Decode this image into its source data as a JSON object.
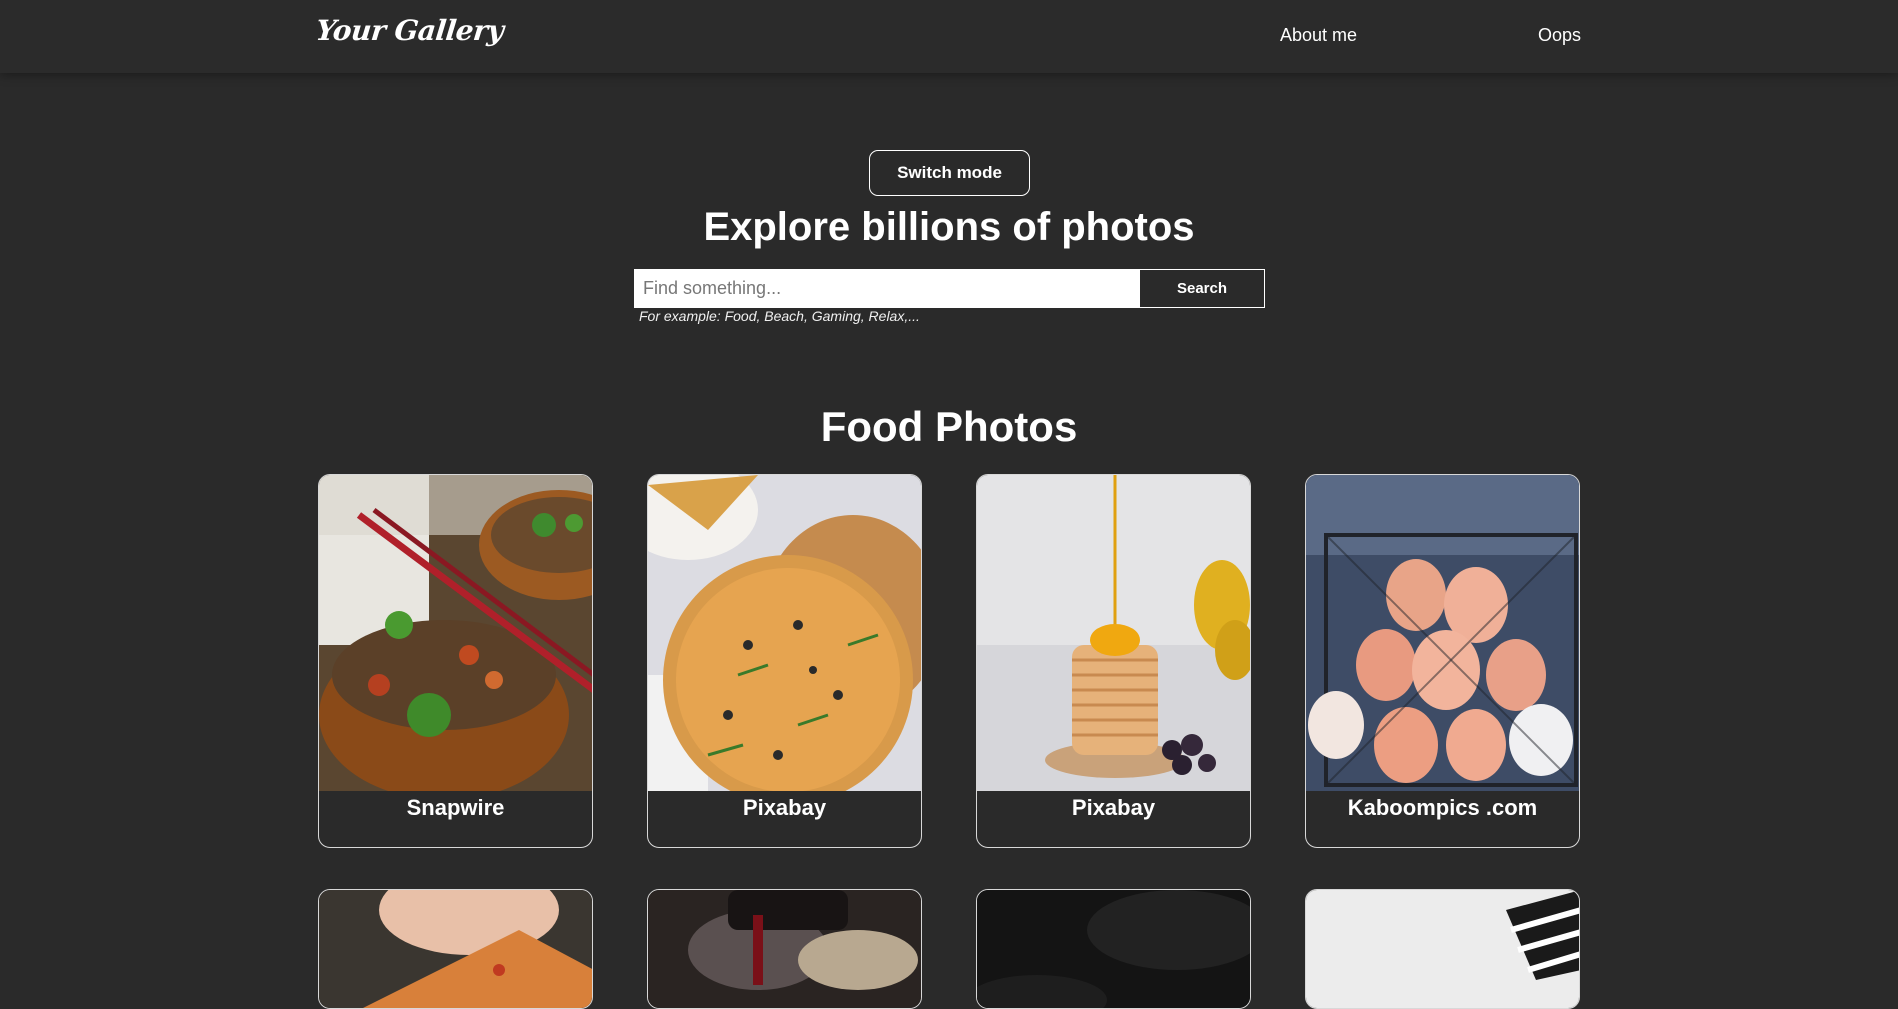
{
  "navbar": {
    "logo": "Your Gallery",
    "links": [
      "About me",
      "Oops"
    ]
  },
  "hero": {
    "switch_label": "Switch mode",
    "title": "Explore billions of photos",
    "search": {
      "placeholder": "Find something...",
      "value": "",
      "button_label": "Search"
    },
    "hint": "For example: Food, Beach, Gaming, Relax,..."
  },
  "gallery": {
    "title": "Food Photos",
    "cards": [
      {
        "caption": "Snapwire",
        "subject": "noodle-bowl-image"
      },
      {
        "caption": "Pixabay",
        "subject": "pizza-image"
      },
      {
        "caption": "Pixabay",
        "subject": "pancakes-image"
      },
      {
        "caption": "Kaboompics .com",
        "subject": "eggs-basket-image"
      }
    ],
    "cards_row2": [
      {
        "subject": "pizza-slice-image"
      },
      {
        "subject": "wine-pour-image"
      },
      {
        "subject": "dark-food-image"
      },
      {
        "subject": "striped-cloth-image"
      }
    ]
  },
  "colors": {
    "background": "#2a2a2a",
    "text": "#ffffff",
    "border": "#d8d8d8"
  }
}
